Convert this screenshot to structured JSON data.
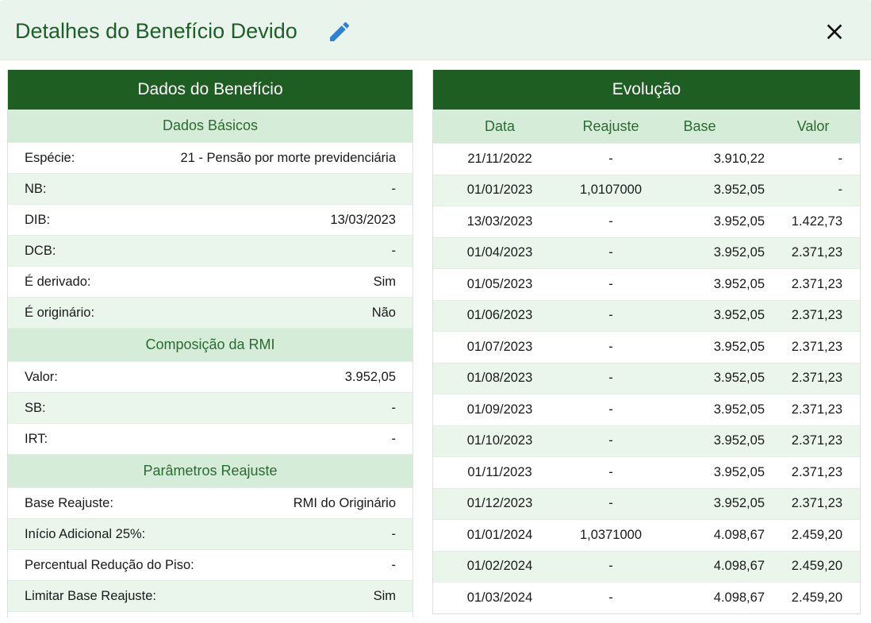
{
  "header": {
    "title": "Detalhes do Benefício Devido",
    "edit_icon": "pencil-icon",
    "close_icon": "close-icon",
    "accent": "#1e5e22"
  },
  "left": {
    "title": "Dados do Benefício",
    "sections": [
      {
        "title": "Dados Básicos",
        "rows": [
          {
            "label": "Espécie:",
            "value": "21 - Pensão por morte previdenciária"
          },
          {
            "label": "NB:",
            "value": "-"
          },
          {
            "label": "DIB:",
            "value": "13/03/2023"
          },
          {
            "label": "DCB:",
            "value": "-"
          },
          {
            "label": "É derivado:",
            "value": "Sim"
          },
          {
            "label": "É originário:",
            "value": "Não"
          }
        ]
      },
      {
        "title": "Composição da RMI",
        "rows": [
          {
            "label": "Valor:",
            "value": "3.952,05"
          },
          {
            "label": "SB:",
            "value": "-"
          },
          {
            "label": "IRT:",
            "value": "-"
          }
        ]
      },
      {
        "title": "Parâmetros Reajuste",
        "rows": [
          {
            "label": "Base Reajuste:",
            "value": "RMI do Originário"
          },
          {
            "label": "Início Adicional 25%:",
            "value": "-"
          },
          {
            "label": "Percentual Redução do Piso:",
            "value": "-"
          },
          {
            "label": "Limitar Base Reajuste:",
            "value": "Sim"
          }
        ]
      }
    ]
  },
  "right": {
    "title": "Evolução",
    "columns": [
      "Data",
      "Reajuste",
      "Base",
      "Valor"
    ],
    "rows": [
      [
        "21/11/2022",
        "-",
        "3.910,22",
        "-"
      ],
      [
        "01/01/2023",
        "1,0107000",
        "3.952,05",
        "-"
      ],
      [
        "13/03/2023",
        "-",
        "3.952,05",
        "1.422,73"
      ],
      [
        "01/04/2023",
        "-",
        "3.952,05",
        "2.371,23"
      ],
      [
        "01/05/2023",
        "-",
        "3.952,05",
        "2.371,23"
      ],
      [
        "01/06/2023",
        "-",
        "3.952,05",
        "2.371,23"
      ],
      [
        "01/07/2023",
        "-",
        "3.952,05",
        "2.371,23"
      ],
      [
        "01/08/2023",
        "-",
        "3.952,05",
        "2.371,23"
      ],
      [
        "01/09/2023",
        "-",
        "3.952,05",
        "2.371,23"
      ],
      [
        "01/10/2023",
        "-",
        "3.952,05",
        "2.371,23"
      ],
      [
        "01/11/2023",
        "-",
        "3.952,05",
        "2.371,23"
      ],
      [
        "01/12/2023",
        "-",
        "3.952,05",
        "2.371,23"
      ],
      [
        "01/01/2024",
        "1,0371000",
        "4.098,67",
        "2.459,20"
      ],
      [
        "01/02/2024",
        "-",
        "4.098,67",
        "2.459,20"
      ],
      [
        "01/03/2024",
        "-",
        "4.098,67",
        "2.459,20"
      ]
    ]
  }
}
